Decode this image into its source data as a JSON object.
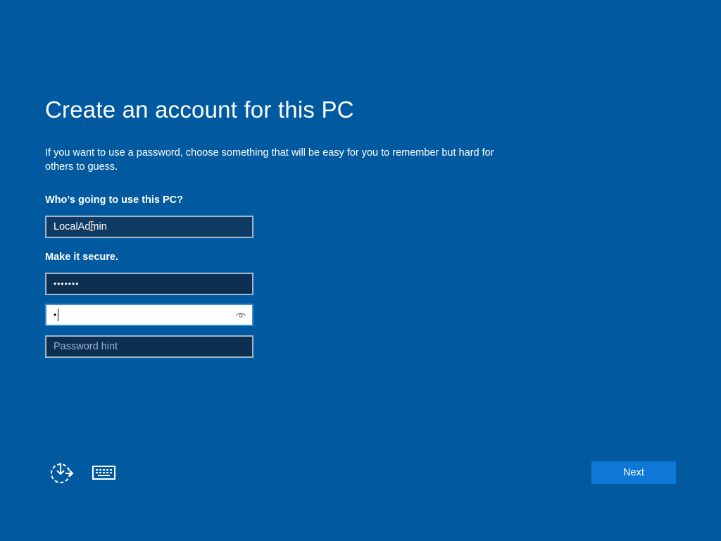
{
  "header": {
    "title": "Create an account for this PC",
    "description": "If you want to use a password, choose something that will be easy for you to remember but hard for others to guess."
  },
  "form": {
    "username_label": "Who’s going to use this PC?",
    "username_value": "LocalAdmin",
    "secure_label": "Make it secure.",
    "password_value": "•••••••",
    "confirm_password_value": "•",
    "hint_placeholder": "Password hint"
  },
  "footer": {
    "accessibility_icon": "ease-of-access-icon",
    "keyboard_icon": "keyboard-icon",
    "next_label": "Next"
  },
  "colors": {
    "background": "#015aa0",
    "input_background": "#0f3b63",
    "input_border": "#9fb6cc",
    "focus_border": "#3b8fd6",
    "button": "#0d78d6"
  }
}
